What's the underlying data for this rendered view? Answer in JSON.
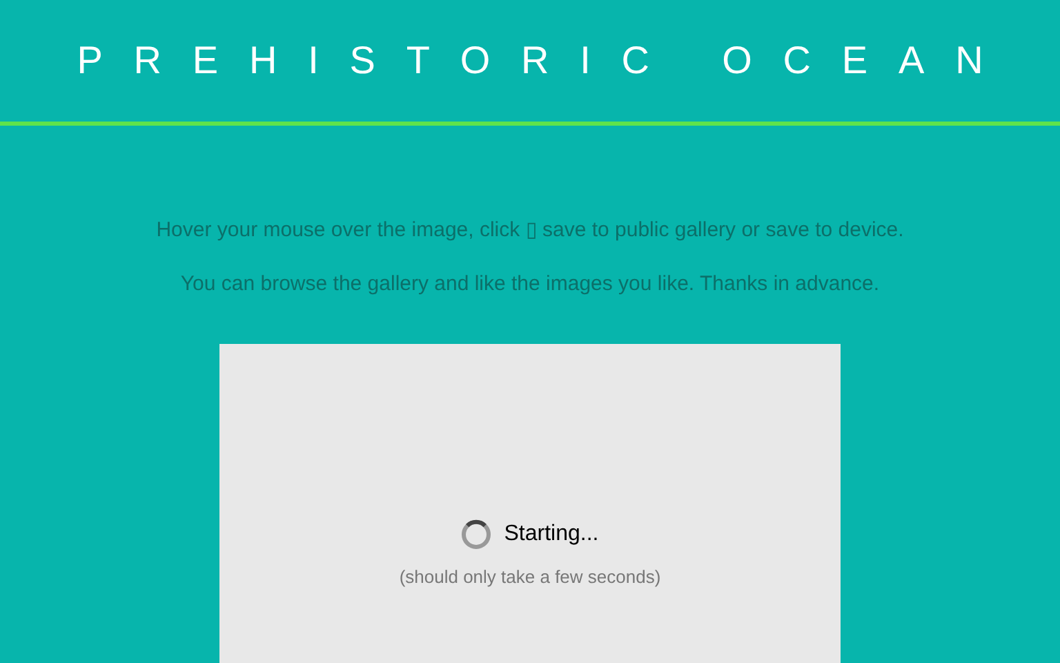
{
  "header": {
    "title": "PREHISTORIC OCEAN"
  },
  "intro": [
    "Hover your mouse over the image, click ▯ save to public gallery or save to device.",
    "You can browse the gallery and like the images you like. Thanks in advance."
  ],
  "loader": {
    "status": "Starting...",
    "note": "(should only take a few seconds)"
  }
}
